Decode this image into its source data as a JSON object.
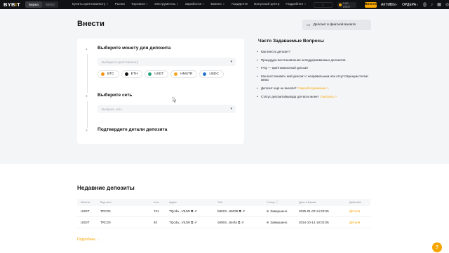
{
  "topbar": {
    "logo_prefix": "BYB",
    "logo_accent": "I",
    "logo_suffix": "T",
    "modes": [
      "Биржа",
      "WEB3"
    ],
    "nav": [
      "Купить криптовалюту",
      "Рынки",
      "Торговля",
      "Инструменты",
      "Заработок",
      "Бизнес",
      "Акциденте",
      "Бонусный центр",
      "Подробнее"
    ],
    "rate": "0,00 USDT",
    "deposit_label": "Внести",
    "assets_label": "АКТИВЫ",
    "orders_label": "ОРДЕРА"
  },
  "header": {
    "title": "Внести",
    "fiat_button": "Депозит в фиатной валюте"
  },
  "deposit": {
    "step1_num": "1",
    "step1_title": "Выберите монету для депозита",
    "coin_placeholder": "Выберите криптовалюту",
    "coins": [
      {
        "label": "BTC",
        "color": "#f7931a"
      },
      {
        "label": "ETH",
        "color": "#121214"
      },
      {
        "label": "USDT",
        "color": "#26a17b"
      },
      {
        "label": "HMSTR",
        "color": "#f5a623"
      },
      {
        "label": "USDC",
        "color": "#2775ca"
      }
    ],
    "step2_num": "2",
    "step2_title": "Выберите сеть",
    "network_placeholder": "Выбрать сеть",
    "step3_num": "3",
    "step3_title": "Подтвердите детали депозита"
  },
  "faq": {
    "title": "Часто Задаваемые Вопросы",
    "items": [
      "Как внести депозит?",
      "Процедура восстановления неподдерживаемых депозитов",
      "FAQ — криптовалютный депозит",
      "Как восстановить мой депозит с неправильным или отсутствующим тегом/мемо",
      "Депозит ещё не внесён?",
      "Статус депозита/вывода для всех монет"
    ],
    "item5_link": "Самообслуживание >",
    "item6_link": "Смотреть >"
  },
  "recent": {
    "title": "Недавние депозиты",
    "columns": [
      "Монета",
      "Вид сети",
      "К-во",
      "Адрес",
      "Тxid",
      "Статус ⓘ",
      "Дата & Время",
      "Действие"
    ],
    "rows": [
      {
        "coin": "USDT",
        "network": "TRC20",
        "qty": "741",
        "address": "TQcda...V5JW",
        "txid": "b8023...69335",
        "status": "Завершено",
        "datetime": "2025-01-03 14:20:05",
        "action": "Детали"
      },
      {
        "coin": "USDT",
        "network": "TRC20",
        "qty": "40",
        "address": "TQcda...V5JW",
        "txid": "d4904...6ecfa",
        "status": "Завершено",
        "datetime": "2024-10-14 19:02:06",
        "action": "Детали"
      }
    ],
    "more_label": "Подробнее"
  },
  "colors": {
    "accent": "#f7a600",
    "topbar": "#101114",
    "page_bg": "#f4f5f7"
  },
  "icons": [
    "search-icon",
    "chevron-down-icon",
    "copy-icon",
    "external-link-icon",
    "bell-icon",
    "user-icon",
    "globe-icon",
    "help-icon"
  ]
}
